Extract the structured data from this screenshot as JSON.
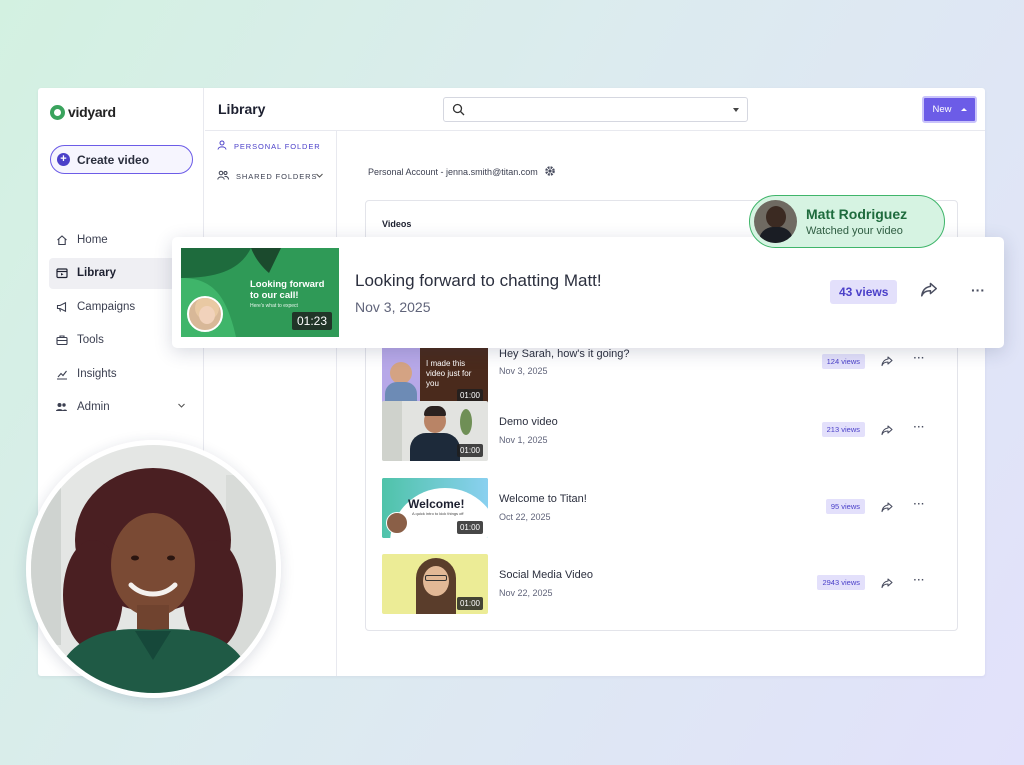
{
  "app": {
    "logo_text": "vidyard"
  },
  "sidebar": {
    "create_label": "Create video",
    "items": [
      {
        "label": "Home",
        "icon": "home-icon",
        "active": false
      },
      {
        "label": "Library",
        "icon": "library-icon",
        "active": true
      },
      {
        "label": "Campaigns",
        "icon": "megaphone-icon",
        "active": false
      },
      {
        "label": "Tools",
        "icon": "briefcase-icon",
        "active": false
      },
      {
        "label": "Insights",
        "icon": "insights-icon",
        "active": false
      },
      {
        "label": "Admin",
        "icon": "people-icon",
        "active": false
      }
    ]
  },
  "header": {
    "title": "Library",
    "search_placeholder": "",
    "new_label": "New"
  },
  "folders": {
    "personal": "Personal folder",
    "shared": "Shared folders"
  },
  "account": {
    "label": "Personal Account - jenna.smith@titan.com"
  },
  "videos": {
    "title": "Videos",
    "rows": [
      {
        "title": "Hey Sarah, how's it going?",
        "date": "Nov 3, 2025",
        "views": "124 views",
        "duration": "01:00",
        "thumb_text": "I made this video just for you"
      },
      {
        "title": "Demo video",
        "date": "Nov 1, 2025",
        "views": "213 views",
        "duration": "01:00"
      },
      {
        "title": "Welcome to Titan!",
        "date": "Oct 22, 2025",
        "views": "95 views",
        "duration": "01:00",
        "thumb_text": "Welcome!",
        "thumb_sub": "A quick intro to kick things off"
      },
      {
        "title": "Social Media Video",
        "date": "Nov 22, 2025",
        "views": "2943 views",
        "duration": "01:00"
      }
    ]
  },
  "highlight": {
    "title": "Looking forward to chatting Matt!",
    "date": "Nov 3, 2025",
    "views": "43 views",
    "duration": "01:23",
    "thumb_text": "Looking forward to our call!",
    "thumb_sub": "Here's what to expect"
  },
  "notification": {
    "name": "Matt Rodriguez",
    "message": "Watched your video"
  },
  "colors": {
    "accent": "#6c5ce7",
    "accent_dark": "#4b40c9",
    "views_bg": "#e3e0fb",
    "notif_green": "#3fb56a"
  }
}
